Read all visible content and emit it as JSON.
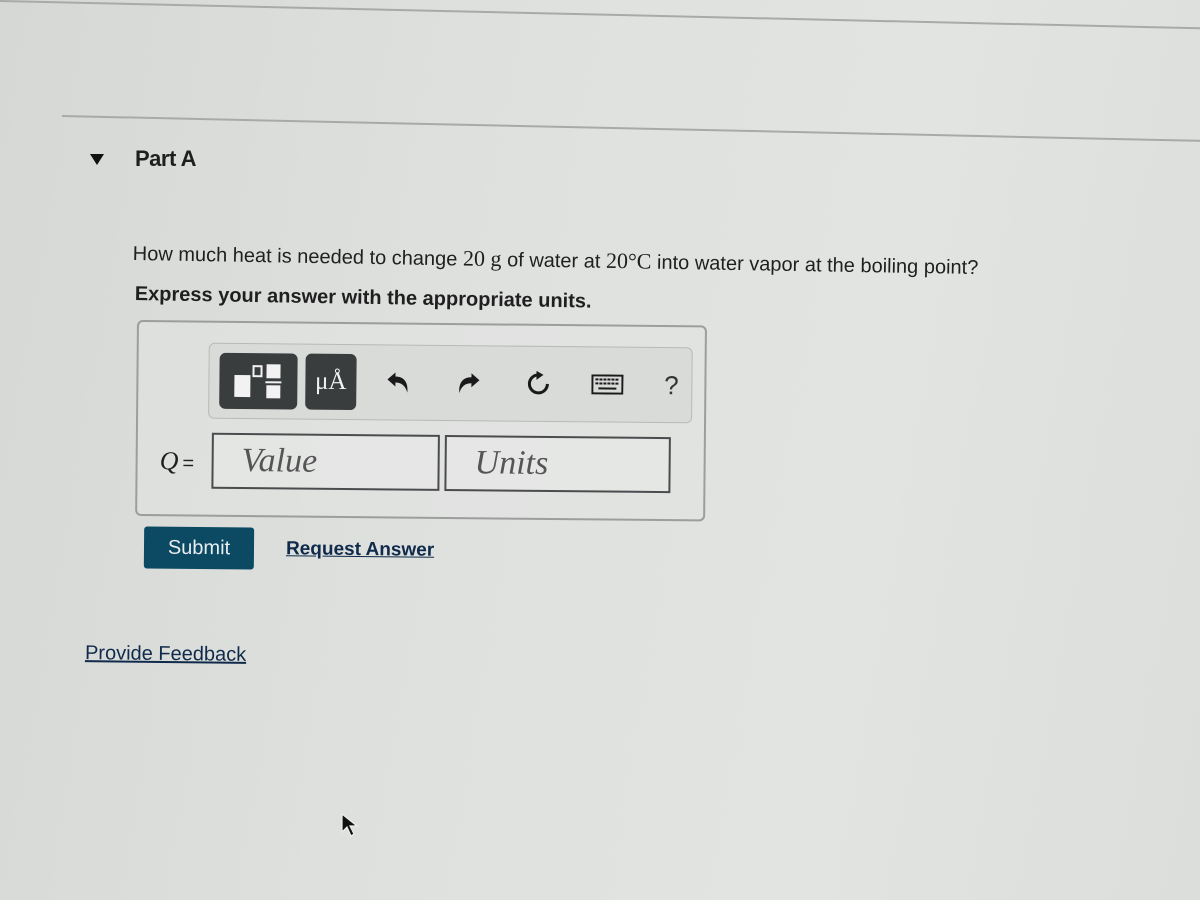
{
  "part": {
    "title": "Part A",
    "expanded": true,
    "collapse_icon": "caret-down-icon"
  },
  "question": {
    "text_before": "How much heat is needed to change ",
    "mass_value": "20",
    "mass_unit": "g",
    "text_middle": " of water at ",
    "temperature": "20°C",
    "text_after": " into water vapor at the boiling point?",
    "instruction": "Express your answer with the appropriate units."
  },
  "toolbar": {
    "buttons": [
      {
        "name": "templates",
        "icon": "templates-icon"
      },
      {
        "name": "units",
        "icon": "units-icon",
        "label": "μÅ"
      },
      {
        "name": "undo",
        "icon": "undo-icon"
      },
      {
        "name": "redo",
        "icon": "redo-icon"
      },
      {
        "name": "reset",
        "icon": "reset-icon"
      },
      {
        "name": "keyboard",
        "icon": "keyboard-icon"
      },
      {
        "name": "help",
        "icon": "help-icon",
        "label": "?"
      }
    ]
  },
  "answer": {
    "variable": "Q",
    "equals": "=",
    "value_placeholder": "Value",
    "value": "",
    "units_placeholder": "Units",
    "units": ""
  },
  "actions": {
    "submit_label": "Submit",
    "request_answer_label": "Request Answer",
    "feedback_label": "Provide Feedback"
  },
  "colors": {
    "submit_bg": "#0b4a62",
    "link": "#0f2a4a",
    "toolbar_button_bg": "#3a3d3e"
  }
}
